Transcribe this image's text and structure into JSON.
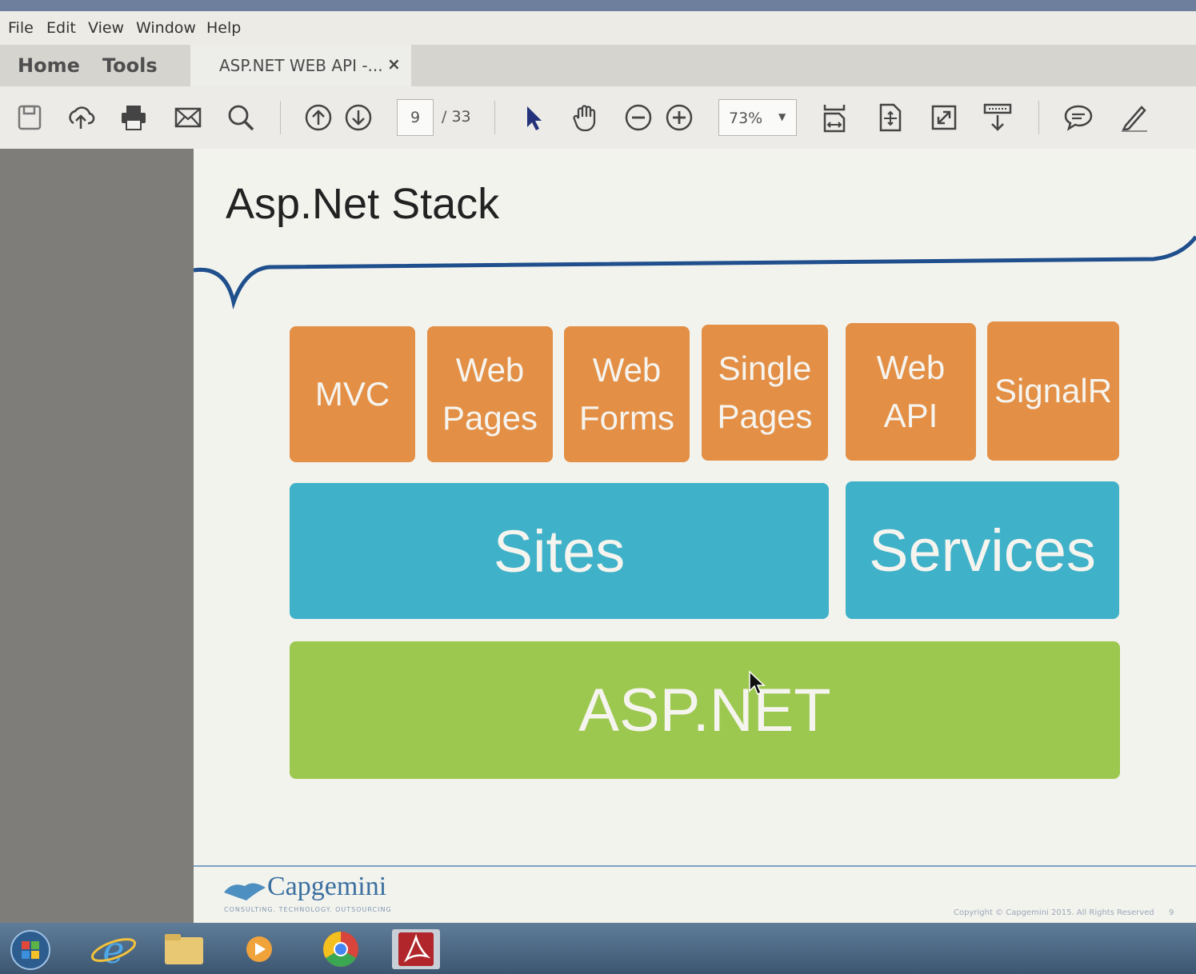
{
  "menu": [
    "File",
    "Edit",
    "View",
    "Window",
    "Help"
  ],
  "nav_tabs": [
    "Home",
    "Tools"
  ],
  "document_tab": {
    "title": "ASP.NET WEB API -...",
    "close": "×"
  },
  "toolbar": {
    "page_current": "9",
    "page_total": "/ 33",
    "zoom": "73%",
    "icons": [
      "save-icon",
      "upload-icon",
      "print-icon",
      "email-icon",
      "search-icon",
      "previous-page-icon",
      "next-page-icon",
      "select-arrow-icon",
      "hand-icon",
      "zoom-out-icon",
      "zoom-in-icon",
      "fit-width-icon",
      "fit-page-icon",
      "full-screen-icon",
      "read-mode-icon",
      "comment-icon",
      "pen-icon"
    ]
  },
  "slide": {
    "title": "Asp.Net Stack",
    "frameworks": [
      "MVC",
      "Web\nPages",
      "Web\nForms",
      "Single\nPages",
      "Web\nAPI",
      "SignalR"
    ],
    "sites": "Sites",
    "services": "Services",
    "platform": "ASP.NET",
    "colors": {
      "framework": "#e38f45",
      "sites": "#3fb1c8",
      "platform": "#9cc850"
    },
    "logo": "Capgemini",
    "logo_tagline": "CONSULTING. TECHNOLOGY. OUTSOURCING",
    "copyright": "Copyright © Capgemini 2015. All Rights Reserved",
    "page_number": "9"
  },
  "taskbar": {
    "apps": [
      "start-orb-icon",
      "internet-explorer-icon",
      "file-explorer-icon",
      "media-player-icon",
      "chrome-icon",
      "acrobat-icon"
    ]
  }
}
